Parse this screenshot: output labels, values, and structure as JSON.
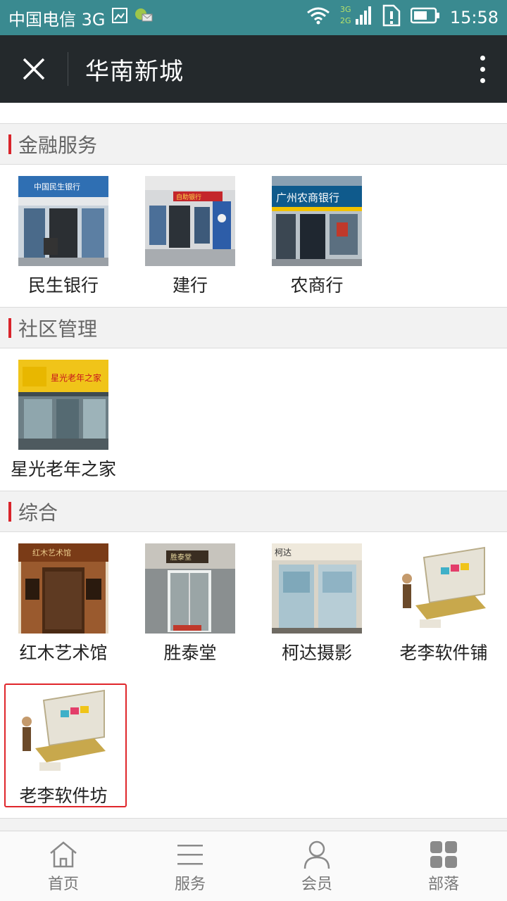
{
  "status_bar": {
    "carrier": "中国电信 3G",
    "network_badge_top": "3G",
    "network_badge_bottom": "2G",
    "time": "15:58"
  },
  "app_bar": {
    "title": "华南新城"
  },
  "sections": [
    {
      "title": "金融服务",
      "items": [
        {
          "label": "民生银行",
          "sign_text": "中国民生银行"
        },
        {
          "label": "建行",
          "sign_text": "自助银行"
        },
        {
          "label": "农商行",
          "sign_text": "广州农商银行"
        }
      ]
    },
    {
      "title": "社区管理",
      "items": [
        {
          "label": "星光老年之家",
          "sign_text": "星光老年之家"
        }
      ]
    },
    {
      "title": "综合",
      "items": [
        {
          "label": "红木艺术馆",
          "sign_text": "红木艺术馆"
        },
        {
          "label": "胜泰堂",
          "sign_text": "胜泰堂"
        },
        {
          "label": "柯达摄影",
          "sign_text": "柯达"
        },
        {
          "label": "老李软件铺"
        },
        {
          "label": "老李软件坊"
        }
      ]
    }
  ],
  "tab_bar": {
    "tabs": [
      {
        "label": "首页",
        "icon": "home-icon"
      },
      {
        "label": "服务",
        "icon": "list-icon"
      },
      {
        "label": "会员",
        "icon": "person-icon"
      },
      {
        "label": "部落",
        "icon": "grid-icon"
      }
    ]
  },
  "colors": {
    "status_bar": "#3a8a90",
    "app_bar": "#24292c",
    "section_accent": "#d9242b",
    "selection_border": "#e0262b"
  }
}
